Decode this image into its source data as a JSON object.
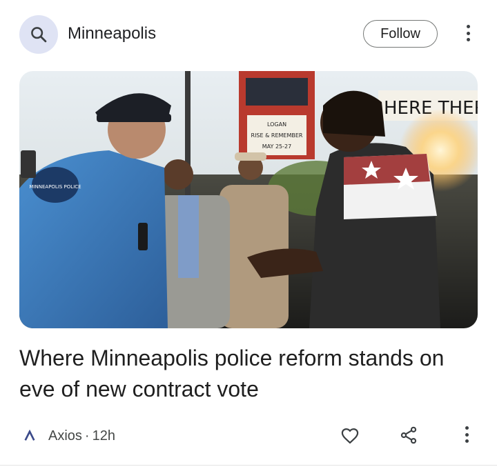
{
  "header": {
    "topic_title": "Minneapolis",
    "follow_label": "Follow",
    "topic_icon": "search-icon",
    "menu_icon": "more-vert-icon"
  },
  "hero_image": {
    "sign_text": "HERE THERES",
    "marquee_lines": [
      "LOGAN",
      "RISE & REMEMBER",
      "MAY 25-27"
    ],
    "patch_text": "MINNEAPOLIS POLICE"
  },
  "article": {
    "headline": "Where Minneapolis police reform stands on eve of new contract vote"
  },
  "footer": {
    "source_name": "Axios",
    "separator": "·",
    "time_ago": "12h",
    "source_logo_icon": "axios-logo-icon",
    "like_icon": "heart-icon",
    "share_icon": "share-icon",
    "menu_icon": "more-vert-icon"
  },
  "colors": {
    "avatar_bg": "#dfe3f4",
    "accent_blue": "#3b4a8a",
    "text_primary": "#1f1f1f",
    "text_secondary": "#444746"
  }
}
